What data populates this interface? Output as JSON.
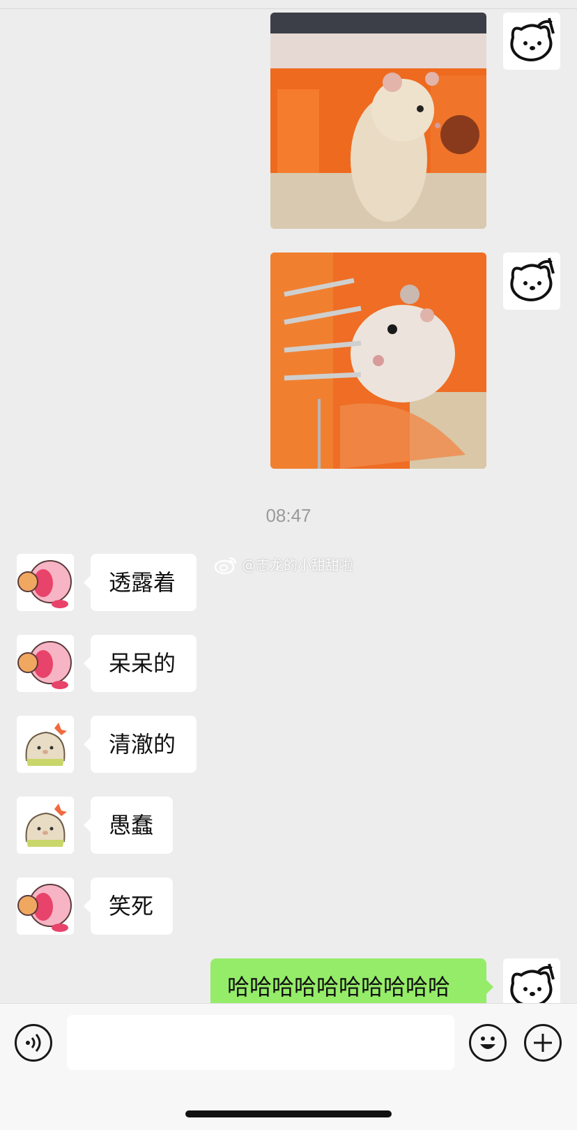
{
  "timestamp": "08:47",
  "watermark": "@志龙的小甜甜啦",
  "messages": [
    {
      "sender": "other",
      "text": "透露着",
      "avatar": "pink-kirby-avatar"
    },
    {
      "sender": "other",
      "text": "呆呆的",
      "avatar": "pink-kirby-avatar"
    },
    {
      "sender": "other",
      "text": "清澈的",
      "avatar": "seal-avatar"
    },
    {
      "sender": "other",
      "text": "愚蠢",
      "avatar": "seal-avatar"
    },
    {
      "sender": "other",
      "text": "笑死",
      "avatar": "pink-kirby-avatar"
    },
    {
      "sender": "me",
      "text": "哈哈哈哈哈哈哈哈哈哈",
      "avatar": "hello-kitty-sketch-avatar"
    }
  ],
  "images": [
    {
      "sender": "me",
      "content": "hamster-photo"
    },
    {
      "sender": "me",
      "content": "hamster-photo"
    }
  ],
  "input": {
    "value": "",
    "placeholder": ""
  },
  "toolbar": {
    "voice_icon": "voice-icon",
    "emoji_icon": "emoji-icon",
    "plus_icon": "plus-icon"
  },
  "colors": {
    "background": "#ededed",
    "my_bubble": "#95ec69",
    "other_bubble": "#ffffff"
  }
}
